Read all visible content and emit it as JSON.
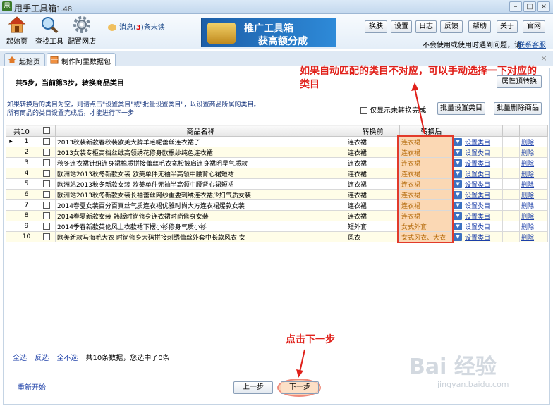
{
  "window": {
    "icon_text": "甩",
    "title": "甩手工具箱",
    "version": "1.48",
    "controls": [
      "–",
      "□",
      "×"
    ]
  },
  "toolbar": {
    "buttons": [
      {
        "label": "起始页"
      },
      {
        "label": "查找工具"
      },
      {
        "label": "配置网店"
      }
    ],
    "message_prefix": "消息(",
    "message_count": "3",
    "message_suffix": ")条未读",
    "banner_line1": "推广工具箱",
    "banner_line2": "获高额分成",
    "right_buttons": [
      "换肤",
      "设置",
      "日志",
      "反馈",
      "帮助",
      "关于",
      "官网"
    ],
    "notice": "不会使用或使用时遇到问题，请",
    "contact": "联系客服"
  },
  "tabs": [
    "起始页",
    "制作阿里数据包"
  ],
  "step_text": "共5步，当前第3步，转换商品类目",
  "attr_convert": "属性预转换",
  "info_line1": "如果转换后的类目为空，则请点击\"设置类目\"或\"批量设置类目\"，以设置商品所属的类目。",
  "info_line2": "所有商品的类目设置完成后，才能进行下一步",
  "show_only_label": "仅显示未转换完成",
  "batch_set": "批量设置类目",
  "batch_delete": "批量删除商品",
  "table": {
    "count_header": "共10",
    "headers": {
      "name": "商品名称",
      "before": "转换前",
      "after": "转换后"
    },
    "rows": [
      {
        "no": "1",
        "name": "2013秋装新款春秋装欧美大牌羊毛呢蕾丝连衣裙子",
        "before": "连衣裙",
        "after": "连衣裙",
        "set": "设置类目",
        "del": "删除"
      },
      {
        "no": "2",
        "name": "2013女装专柜高档丝绒高领绣花修身欧根纱纯色连衣裙",
        "before": "连衣裙",
        "after": "连衣裙",
        "set": "设置类目",
        "del": "删除"
      },
      {
        "no": "3",
        "name": "秋冬连衣裙针织连身裙棉质拼接蕾丝毛衣宽松披肩连身裙明星气质款",
        "before": "连衣裙",
        "after": "连衣裙",
        "set": "设置类目",
        "del": "删除"
      },
      {
        "no": "4",
        "name": "欧洲站2013秋冬新款女装 欧美单件无袖半高领中腰背心裙短裙",
        "before": "连衣裙",
        "after": "连衣裙",
        "set": "设置类目",
        "del": "删除"
      },
      {
        "no": "5",
        "name": "欧洲站2013秋冬新款女装 欧美单件无袖半高领中腰背心裙短裙",
        "before": "连衣裙",
        "after": "连衣裙",
        "set": "设置类目",
        "del": "删除"
      },
      {
        "no": "6",
        "name": "欧洲站2013秋冬新款女装长袖蕾丝网纱重要刺绣连衣裙少妇气质女装",
        "before": "连衣裙",
        "after": "连衣裙",
        "set": "设置类目",
        "del": "删除"
      },
      {
        "no": "7",
        "name": "2014春夏女装百分百真丝气质连衣裙优雅时尚大方连衣裙爆款女装",
        "before": "连衣裙",
        "after": "连衣裙",
        "set": "设置类目",
        "del": "删除"
      },
      {
        "no": "8",
        "name": "2014春夏新款女装 韩版时尚修身连衣裙时尚修身女装",
        "before": "连衣裙",
        "after": "连衣裙",
        "set": "设置类目",
        "del": "删除"
      },
      {
        "no": "9",
        "name": "2014季春新款英伦风上衣款裙下摆小衫修身气质小衫",
        "before": "短外套",
        "after": "女式外套",
        "set": "设置类目",
        "del": "删除"
      },
      {
        "no": "10",
        "name": "欧美新款马海毛大衣 时尚修身大码拼接刺绣蕾丝外套中长款风衣 女",
        "before": "风衣",
        "after": "女式风衣、大衣",
        "set": "设置类目",
        "del": "删除"
      }
    ]
  },
  "annotation_top": "如果自动匹配的类目不对应，可以手动选择一下对应的类目",
  "annotation_bottom": "点击下一步",
  "bottom_links": [
    "全选",
    "反选",
    "全不选"
  ],
  "summary": "共10条数据，您选中了0条",
  "restart": "重新开始",
  "prev": "上一步",
  "next": "下一步",
  "watermark_main": "Bai 经验",
  "watermark_sub": "jingyan.baidu.com",
  "colors": {
    "annotation_red": "#e0201a",
    "after_cell": "#fbd8b4",
    "link_blue": "#1c3fa8",
    "banner_blue": "#1c5ea8"
  }
}
